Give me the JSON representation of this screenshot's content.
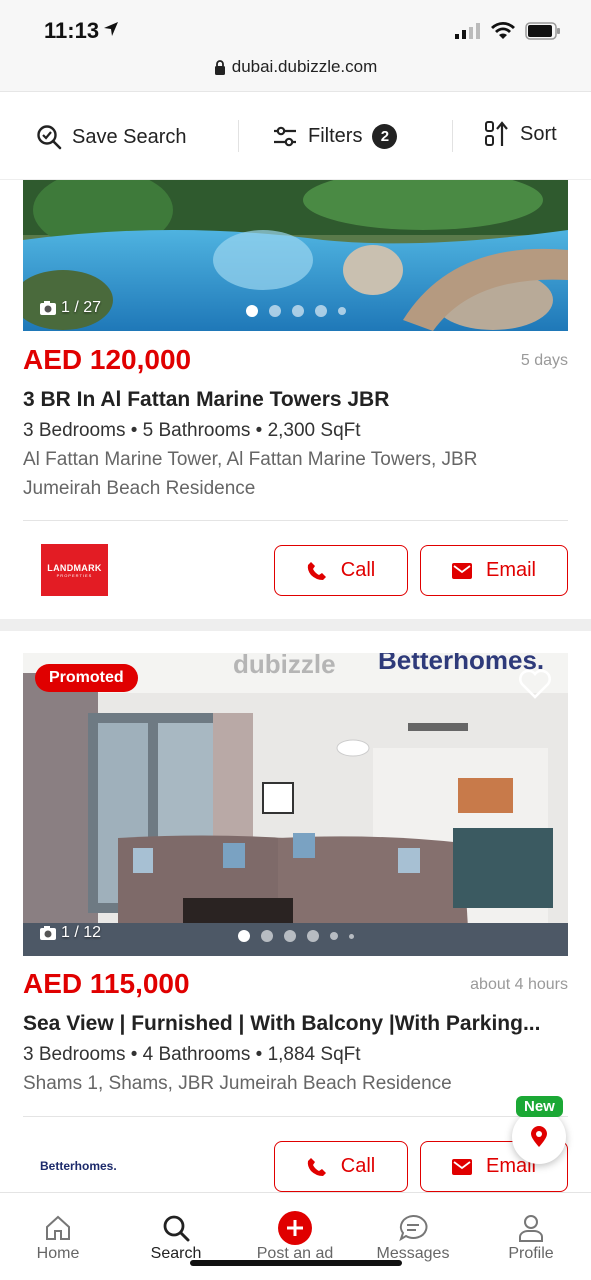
{
  "status_bar": {
    "time": "11:13"
  },
  "browser": {
    "url": "dubai.dubizzle.com"
  },
  "toolbar": {
    "save_search": "Save Search",
    "filters": "Filters",
    "filters_count": "2",
    "sort": "Sort"
  },
  "listings": [
    {
      "photo_count": "1 / 27",
      "price": "AED 120,000",
      "age": "5 days",
      "title": "3 BR In Al Fattan Marine Towers JBR",
      "specs": "3 Bedrooms • 5 Bathrooms •  2,300 SqFt",
      "address": "Al Fattan Marine Tower, Al Fattan Marine Towers, JBR Jumeirah Beach Residence",
      "agency_logo": "LANDMARK",
      "agency_logo_sub": "PROPERTIES",
      "call_label": "Call",
      "email_label": "Email"
    },
    {
      "badge": "Promoted",
      "watermark_left": "dubizzle",
      "watermark_right": "Betterhomes.",
      "photo_count": "1 / 12",
      "price": "AED 115,000",
      "age": "about 4 hours",
      "title": "Sea View | Furnished | With Balcony |With Parking...",
      "specs": "3 Bedrooms • 4 Bathrooms •  1,884 SqFt",
      "address": "Shams 1, Shams, JBR Jumeirah Beach Residence",
      "agency_logo": "Betterhomes.",
      "call_label": "Call",
      "email_label": "Email"
    }
  ],
  "map_button": {
    "new_tag": "New"
  },
  "bottom_nav": [
    {
      "label": "Home",
      "icon": "home-icon"
    },
    {
      "label": "Search",
      "icon": "search-icon"
    },
    {
      "label": "Post an ad",
      "icon": "plus-icon"
    },
    {
      "label": "Messages",
      "icon": "chat-icon"
    },
    {
      "label": "Profile",
      "icon": "user-icon"
    }
  ],
  "colors": {
    "brand_red": "#e00000",
    "new_green": "#1ba835"
  }
}
